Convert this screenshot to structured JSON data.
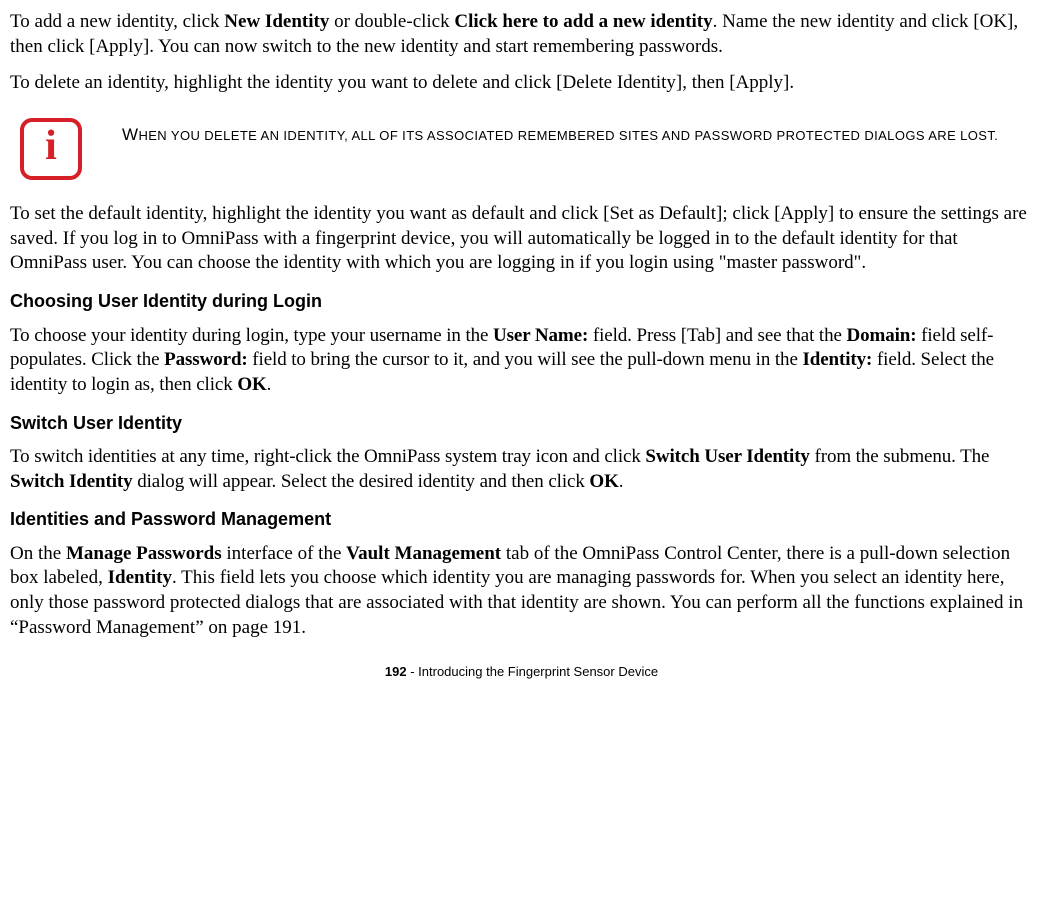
{
  "p1": {
    "a": "To add a new identity, click ",
    "b": "New Identity",
    "c": " or double-click ",
    "d": "Click here to add a new identity",
    "e": ". Name the new identity and click [OK], then click [Apply]. You can now switch to the new identity and start remembering passwords."
  },
  "p2": "To delete an identity, highlight the identity you want to delete and click [Delete Identity], then [Apply].",
  "info": "When you delete an identity, all of its associated remembered sites and password protected dialogs are lost.",
  "p3": "To set the default identity, highlight the identity you want as default and click [Set as Default]; click [Apply] to ensure the settings are saved. If you log in to OmniPass with a fingerprint device, you will automatically be logged in to the default identity for that OmniPass user. You can choose the identity with which you are logging in if you login using \"master password\".",
  "h1": "Choosing User Identity during Login",
  "p4": {
    "a": "To choose your identity during login, type your username in the ",
    "b": "User Name:",
    "c": " field. Press [Tab] and see that the ",
    "d": "Domain:",
    "e": " field self-populates. Click the ",
    "f": "Password:",
    "g": " field to bring the cursor to it, and you will see the pull-down menu in the ",
    "h": "Identity:",
    "i": " field. Select the identity to login as, then click ",
    "j": "OK",
    "k": "."
  },
  "h2": "Switch User Identity",
  "p5": {
    "a": "To switch identities at any time, right-click the OmniPass system tray icon and click ",
    "b": "Switch User Identity",
    "c": " from the submenu. The ",
    "d": "Switch Identity",
    "e": " dialog will appear. Select the desired identity and then click ",
    "f": "OK",
    "g": "."
  },
  "h3": "Identities and Password Management",
  "p6": {
    "a": "On the ",
    "b": "Manage Passwords",
    "c": " interface of the ",
    "d": "Vault Management",
    "e": " tab of the OmniPass Control Center, there is a pull-down selection box labeled, ",
    "f": "Identity",
    "g": ". This field lets you choose which identity you are managing passwords for. When you select an identity here, only those password protected dialogs that are associated with that identity are shown. You can perform all the functions explained in “Password Management” on page 191."
  },
  "footer": {
    "page": "192",
    "sep": " - ",
    "title": "Introducing the Fingerprint Sensor Device"
  }
}
